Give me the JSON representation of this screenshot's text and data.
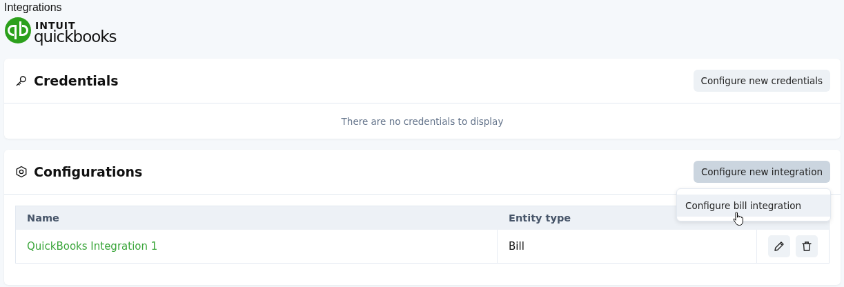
{
  "page_title": "Integrations",
  "logo": {
    "brand": "INTUIT",
    "product": "quickbooks"
  },
  "credentials": {
    "title": "Credentials",
    "button": {
      "label": "Configure new credentials",
      "active": false
    },
    "empty_message": "There are no credentials to display"
  },
  "configurations": {
    "title": "Configurations",
    "button": {
      "label": "Configure new integration",
      "active": true
    },
    "menu": [
      {
        "label": "Configure bill integration",
        "highlighted": true
      }
    ],
    "table": {
      "columns": [
        "Name",
        "Entity type"
      ],
      "rows": [
        {
          "name": "QuickBooks Integration 1",
          "entity_type": "Bill"
        }
      ]
    }
  }
}
